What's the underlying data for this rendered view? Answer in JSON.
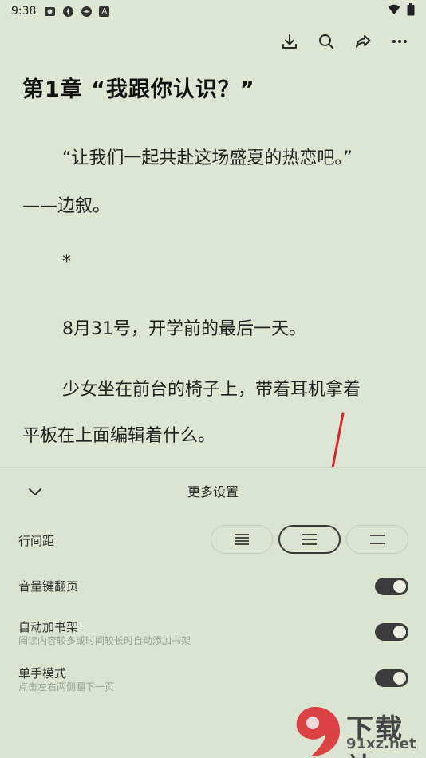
{
  "status_bar": {
    "time": "9:38",
    "badge": "A"
  },
  "toolbar": {
    "icons": [
      "download-icon",
      "search-icon",
      "share-icon",
      "more-icon"
    ]
  },
  "chapter": {
    "title": "第1章 “我跟你认识？”"
  },
  "content": {
    "paragraphs": [
      "“让我们一起共赴这场盛夏的热恋吧。”",
      "——边叙。",
      "*",
      "8月31号，开学前的最后一天。",
      "少女坐在前台的椅子上，带着耳机拿着",
      "平板在上面编辑着什么。"
    ]
  },
  "panel": {
    "title": "更多设置",
    "line_spacing_label": "行间距",
    "line_spacing_selected": "medium",
    "volume_key_label": "音量键翻页",
    "volume_key_on": true,
    "auto_shelf_label": "自动加书架",
    "auto_shelf_sub": "阅读内容较多或时间较长时自动添加书架",
    "auto_shelf_on": true,
    "one_hand_label": "单手模式",
    "one_hand_sub": "点击左右两侧翻下一页",
    "one_hand_on": true
  },
  "watermark": {
    "logo_glyph": "9",
    "text": "下载站",
    "url": "91xz.net"
  },
  "colors": {
    "background": "#dde5d3",
    "toggle_on": "#3b3b3b",
    "arrow": "#d9262b"
  }
}
